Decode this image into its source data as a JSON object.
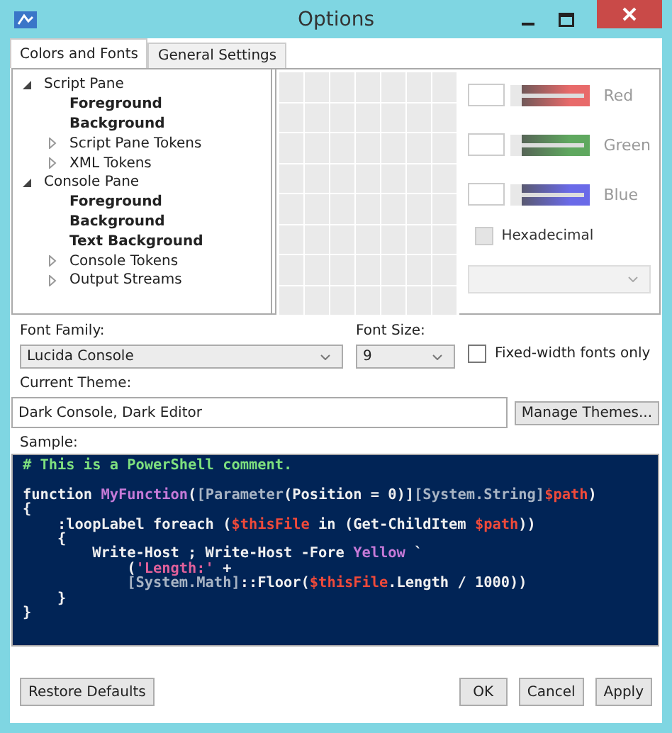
{
  "window": {
    "title": "Options"
  },
  "tabs": [
    {
      "label": "Colors and Fonts",
      "selected": true
    },
    {
      "label": "General Settings",
      "selected": false
    }
  ],
  "tree": [
    {
      "kind": "group",
      "label": "Script Pane",
      "expanded": true,
      "children": [
        {
          "kind": "color",
          "label": "Foreground"
        },
        {
          "kind": "color",
          "label": "Background"
        },
        {
          "kind": "group",
          "label": "Script Pane Tokens",
          "expanded": false
        },
        {
          "kind": "group",
          "label": "XML Tokens",
          "expanded": false
        }
      ]
    },
    {
      "kind": "group",
      "label": "Console Pane",
      "expanded": true,
      "children": [
        {
          "kind": "color",
          "label": "Foreground"
        },
        {
          "kind": "color",
          "label": "Background"
        },
        {
          "kind": "color",
          "label": "Text Background"
        },
        {
          "kind": "group",
          "label": "Console Tokens",
          "expanded": false
        },
        {
          "kind": "group",
          "label": "Output Streams",
          "expanded": false
        }
      ]
    }
  ],
  "channels": [
    {
      "label": "Red",
      "color": "#e86a6a",
      "level": 0,
      "disabled": true
    },
    {
      "label": "Green",
      "color": "#5fa85f",
      "level": 0,
      "disabled": true
    },
    {
      "label": "Blue",
      "color": "#6a6ae8",
      "level": 0,
      "disabled": true
    }
  ],
  "hexadecimal": {
    "label": "Hexadecimal",
    "checked": false,
    "disabled": true
  },
  "font_family": {
    "label": "Font Family:",
    "value": "Lucida Console"
  },
  "font_size": {
    "label": "Font Size:",
    "value": "9"
  },
  "fixed_width": {
    "label": "Fixed-width fonts only",
    "checked": false
  },
  "theme": {
    "label": "Current Theme:",
    "value": "Dark Console, Dark Editor",
    "button": "Manage Themes..."
  },
  "sample": {
    "label": "Sample:",
    "lines": [
      {
        "kind": "code",
        "tokens": [
          {
            "text": "# This is a PowerShell comment.",
            "color": "#7ee07e"
          }
        ]
      },
      {
        "kind": "blank"
      },
      {
        "kind": "code",
        "tokens": [
          {
            "text": "function ",
            "color": "#f0f0f0"
          },
          {
            "text": "MyFunction",
            "color": "#c67ad8"
          },
          {
            "text": "(",
            "color": "#f0f0f0"
          },
          {
            "text": "[Parameter",
            "color": "#a8b4c4"
          },
          {
            "text": "(Position = 0)]",
            "color": "#f0f0f0"
          },
          {
            "text": "[System.String]",
            "color": "#a8b4c4"
          },
          {
            "text": "$path",
            "color": "#f04a3a"
          },
          {
            "text": ")",
            "color": "#f0f0f0"
          }
        ]
      },
      {
        "kind": "code",
        "tokens": [
          {
            "text": "{",
            "color": "#f0f0f0"
          }
        ]
      },
      {
        "kind": "code",
        "tokens": [
          {
            "text": "    :loopLabel foreach (",
            "color": "#f0f0f0"
          },
          {
            "text": "$thisFile",
            "color": "#f04a3a"
          },
          {
            "text": " in (Get-ChildItem ",
            "color": "#f0f0f0"
          },
          {
            "text": "$path",
            "color": "#f04a3a"
          },
          {
            "text": "))",
            "color": "#f0f0f0"
          }
        ]
      },
      {
        "kind": "code",
        "tokens": [
          {
            "text": "    {",
            "color": "#f0f0f0"
          }
        ]
      },
      {
        "kind": "code",
        "tokens": [
          {
            "text": "        Write-Host ; Write-Host -Fore ",
            "color": "#f0f0f0"
          },
          {
            "text": "Yellow",
            "color": "#c67ad8"
          },
          {
            "text": " `",
            "color": "#f0f0f0"
          }
        ]
      },
      {
        "kind": "code",
        "tokens": [
          {
            "text": "            (",
            "color": "#f0f0f0"
          },
          {
            "text": "'Length:'",
            "color": "#e0609a"
          },
          {
            "text": " +",
            "color": "#f0f0f0"
          }
        ]
      },
      {
        "kind": "code",
        "tokens": [
          {
            "text": "            [System.Math]",
            "color": "#a8b4c4"
          },
          {
            "text": "::Floor(",
            "color": "#f0f0f0"
          },
          {
            "text": "$thisFile",
            "color": "#f04a3a"
          },
          {
            "text": ".Length / 1000))",
            "color": "#f0f0f0"
          }
        ]
      },
      {
        "kind": "code",
        "tokens": [
          {
            "text": "    }",
            "color": "#f0f0f0"
          }
        ]
      },
      {
        "kind": "code",
        "tokens": [
          {
            "text": "}",
            "color": "#f0f0f0"
          }
        ]
      }
    ]
  },
  "buttons": {
    "restore": "Restore Defaults",
    "actions": [
      "OK",
      "Cancel",
      "Apply"
    ]
  }
}
